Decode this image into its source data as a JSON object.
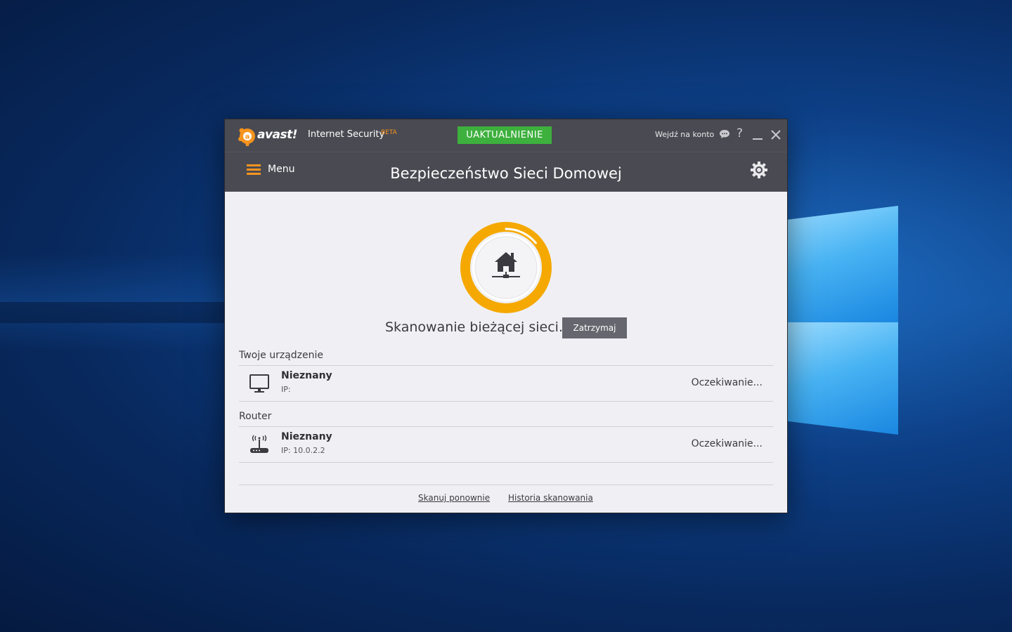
{
  "titlebar": {
    "brand": "avast!",
    "product": "Internet Security",
    "beta": "BETA",
    "update_button": "UAKTUALNIENIE",
    "account_link": "Wejdź na konto"
  },
  "header": {
    "menu_label": "Menu",
    "title": "Bezpieczeństwo Sieci Domowej"
  },
  "scan": {
    "status": "Skanowanie bieżącej sieci...",
    "stop_button": "Zatrzymaj",
    "progress": 0.14
  },
  "sections": [
    {
      "label": "Twoje urządzenie",
      "device": {
        "name": "Nieznany",
        "ip": "IP:",
        "status": "Oczekiwanie...",
        "icon": "monitor-icon"
      }
    },
    {
      "label": "Router",
      "device": {
        "name": "Nieznany",
        "ip": "IP: 10.0.2.2",
        "status": "Oczekiwanie...",
        "icon": "router-icon"
      }
    }
  ],
  "footer": {
    "rescan": "Skanuj ponownie",
    "history": "Historia skanowania"
  },
  "colors": {
    "accent": "#f7941e",
    "ring": "#f5a800",
    "update": "#3db03d",
    "header": "#4a4a52"
  }
}
